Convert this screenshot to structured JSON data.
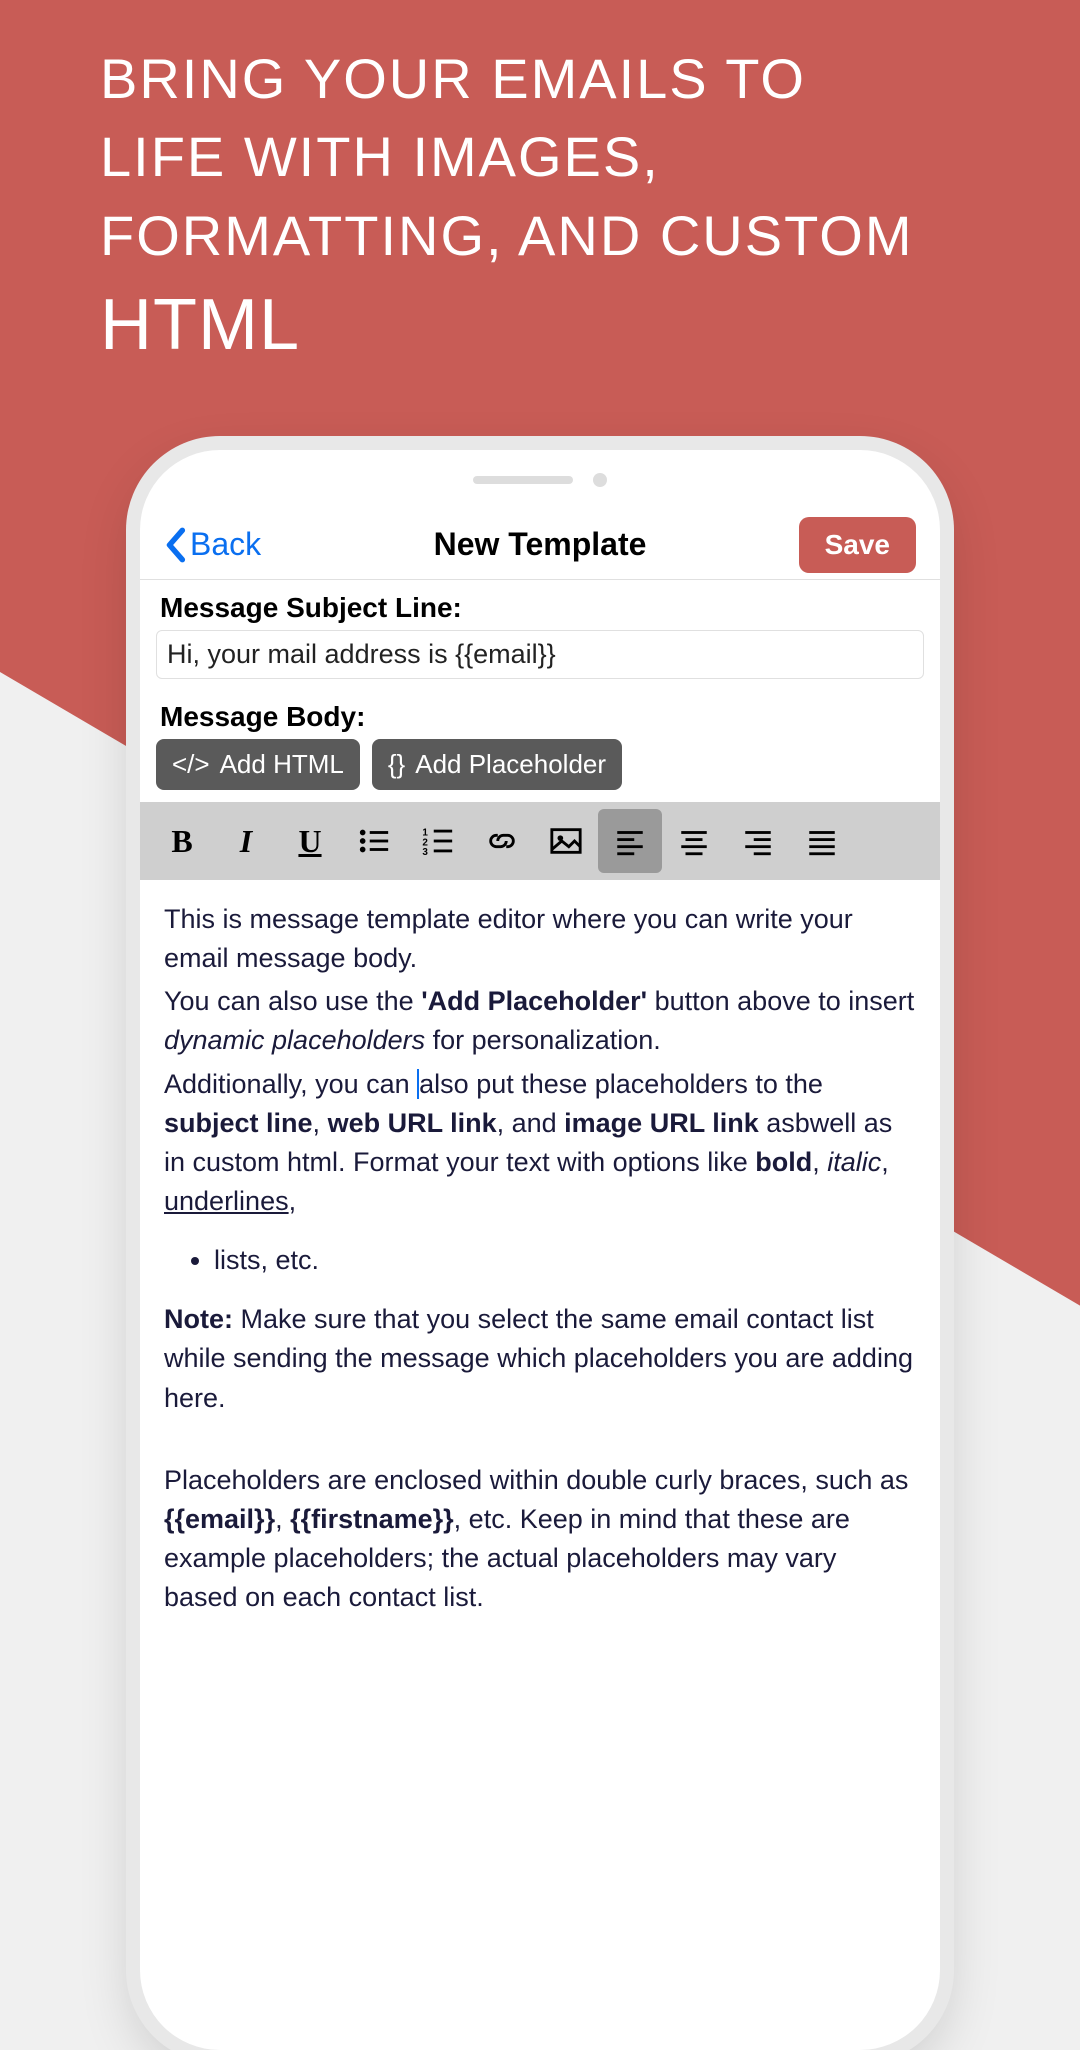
{
  "headline": {
    "line1": "Bring your emails to",
    "line2": "life with images,",
    "line3": "formatting, and custom",
    "line4": "HTML"
  },
  "navbar": {
    "back_label": "Back",
    "title": "New Template",
    "save_label": "Save"
  },
  "subject": {
    "label": "Message Subject Line:",
    "value": "Hi, your mail address is {{email}}"
  },
  "body": {
    "label": "Message Body:",
    "add_html_label": "Add HTML",
    "add_placeholder_label": "Add Placeholder"
  },
  "editor": {
    "p1_a": "This is message template editor where you can write your email message body.",
    "p2_a": "You can also use the ",
    "p2_b": "'Add Placeholder'",
    "p2_c": " button above to insert ",
    "p2_d": "dynamic placeholders",
    "p2_e": " for personalization.",
    "p3_a": "Additionally, you can ",
    "p3_b": "also put these placeholders to the ",
    "p3_c": "subject line",
    "p3_d": ", ",
    "p3_e": "web URL link",
    "p3_f": ", and ",
    "p3_g": "image URL link",
    "p3_h": " asbwell as in custom html. Format your text with options like ",
    "p3_i": "bold",
    "p3_j": ", ",
    "p3_k": "italic",
    "p3_l": ", ",
    "p3_m": "underlines",
    "p3_n": ",",
    "list1": "lists, etc.",
    "p4_a": "Note:",
    "p4_b": " Make sure that you select the same email contact list while sending the message which placeholders you are adding here.",
    "p5_a": "Placeholders are enclosed within double curly braces, such as ",
    "p5_b": "{{email}}",
    "p5_c": ", ",
    "p5_d": "{{firstname}}",
    "p5_e": ", etc. Keep in mind that these are example placeholders; the actual placeholders may vary based on each contact list."
  }
}
